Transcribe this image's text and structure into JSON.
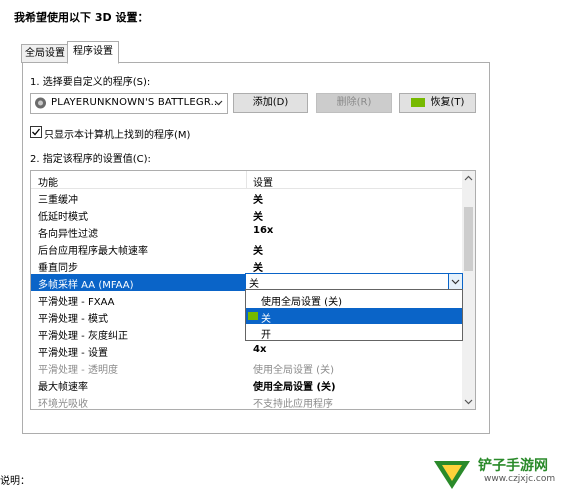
{
  "heading": "我希望使用以下 3D 设置：",
  "tabs": [
    {
      "label": "全局设置",
      "active": false
    },
    {
      "label": "程序设置",
      "active": true
    }
  ],
  "step1": {
    "label": "1. 选择要自定义的程序(S):",
    "program": "PLAYERUNKNOWN'S BATTLEGR...",
    "buttons": {
      "add": "添加(D)",
      "delete": "删除(R)",
      "restore": "恢复(T)"
    }
  },
  "checkbox": {
    "label": "只显示本计算机上找到的程序(M)",
    "checked": true
  },
  "step2": {
    "label": "2. 指定该程序的设置值(C):"
  },
  "list": {
    "header": {
      "feature": "功能",
      "setting": "设置"
    },
    "rows": [
      {
        "feature": "三重缓冲",
        "setting": "关"
      },
      {
        "feature": "低延时模式",
        "setting": "关"
      },
      {
        "feature": "各向异性过滤",
        "setting": "16x"
      },
      {
        "feature": "后台应用程序最大帧速率",
        "setting": "关"
      },
      {
        "feature": "垂直同步",
        "setting": "关"
      },
      {
        "feature": "多帧采样 AA (MFAA)",
        "setting": "关"
      },
      {
        "feature": "平滑处理 - FXAA",
        "setting": ""
      },
      {
        "feature": "平滑处理 - 模式",
        "setting": ""
      },
      {
        "feature": "平滑处理 - 灰度纠正",
        "setting": ""
      },
      {
        "feature": "平滑处理 - 设置",
        "setting": "4x"
      },
      {
        "feature": "平滑处理 - 透明度",
        "setting": "使用全局设置 (关)"
      },
      {
        "feature": "最大帧速率",
        "setting": "使用全局设置 (关)"
      },
      {
        "feature": "环境光吸收",
        "setting": "不支持此应用程序"
      }
    ]
  },
  "combo": {
    "value": "关"
  },
  "dropdown": {
    "options": [
      "使用全局设置 (关)",
      "关",
      "开"
    ],
    "highlighted": 1
  },
  "note": "说明：",
  "watermark": {
    "text": "铲子手游网",
    "url": "www.czjxjc.com"
  },
  "colors": {
    "selection": "#0a64c8",
    "nvidia_green": "#76b900"
  }
}
